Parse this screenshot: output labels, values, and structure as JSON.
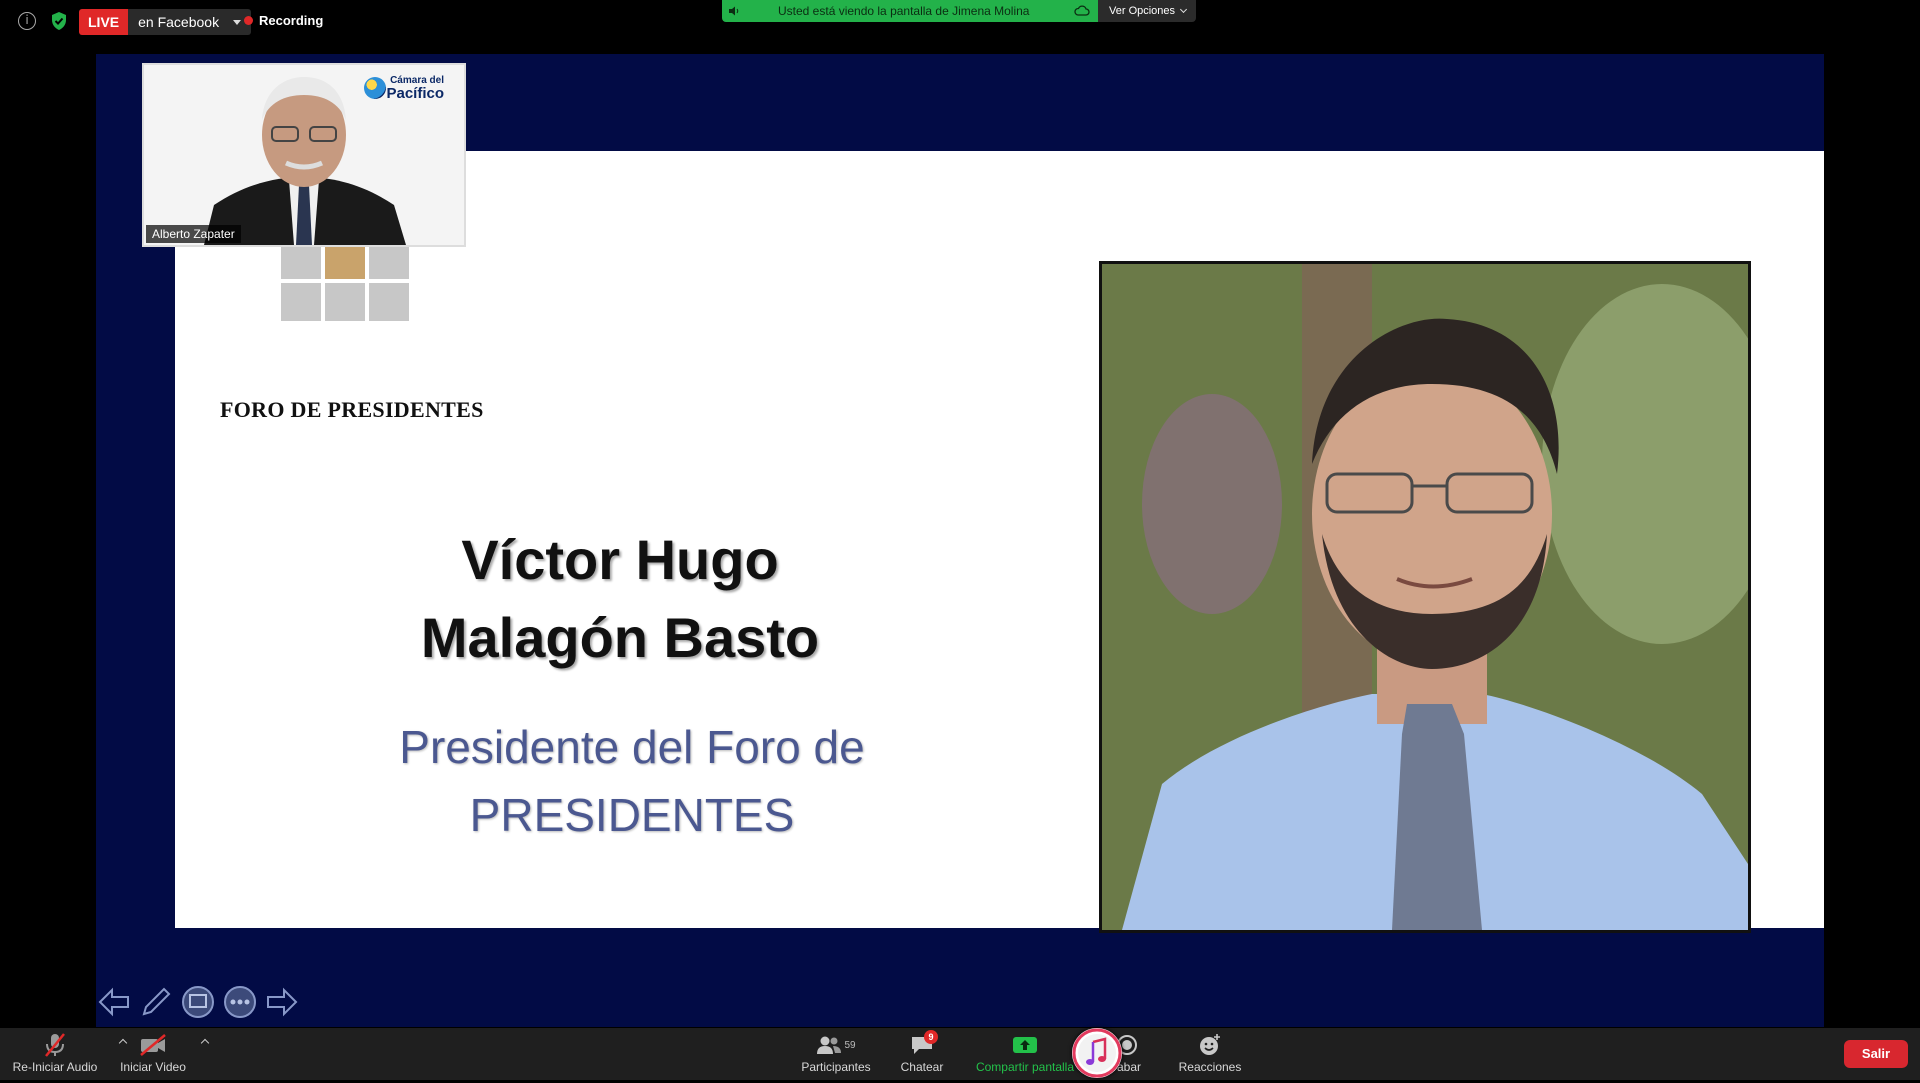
{
  "topbar": {
    "live_label": "LIVE",
    "live_destination": "en Facebook",
    "recording_label": "Recording",
    "share_notice": "Usted está viendo la pantalla de Jimena Molina",
    "view_options_label": "Ver Opciones"
  },
  "slide": {
    "forum_title": "FORO DE PRESIDENTES",
    "speaker_name_line1": "Víctor Hugo",
    "speaker_name_line2": "Malagón Basto",
    "speaker_role_line1": "Presidente del Foro de",
    "speaker_role_line2": "PRESIDENTES",
    "colors": {
      "background": "#020b45",
      "role_text": "#4b5890",
      "accent_square": "#c9a36b"
    }
  },
  "presenter": {
    "name": "Alberto Zapater",
    "org_logo_line1": "Cámara del",
    "org_logo_line2": "Pacífico"
  },
  "toolbar": {
    "audio_label": "Re-Iniciar Audio",
    "video_label": "Iniciar Video",
    "participants_label": "Participantes",
    "participants_count": "59",
    "chat_label": "Chatear",
    "chat_badge": "9",
    "share_label": "Compartir pantalla",
    "record_label": "rabar",
    "reactions_label": "Reacciones",
    "leave_label": "Salir"
  },
  "icons": [
    "info-icon",
    "shield-icon",
    "speaker-icon",
    "cloud-icon",
    "mic-muted-icon",
    "video-off-icon",
    "participants-icon",
    "chat-icon",
    "share-screen-icon",
    "record-icon",
    "reactions-icon",
    "music-app-icon",
    "arrow-left-icon",
    "pen-icon",
    "whiteboard-icon",
    "more-icon",
    "arrow-right-icon"
  ]
}
